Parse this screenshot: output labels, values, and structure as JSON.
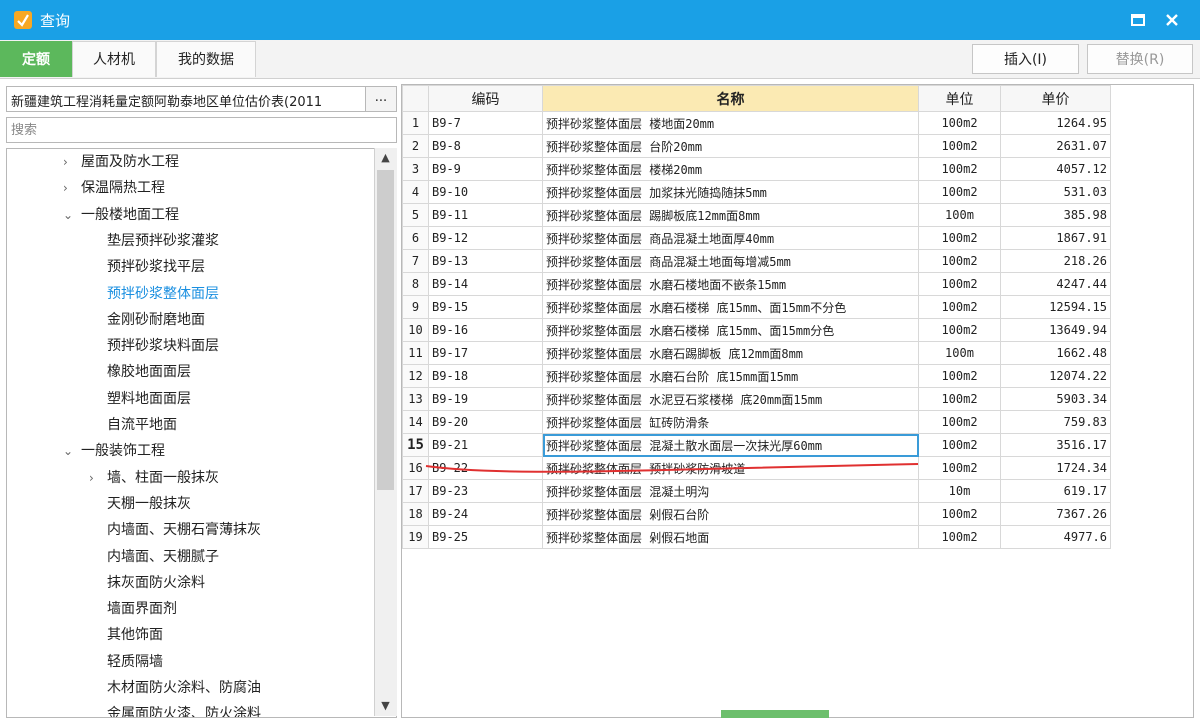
{
  "window": {
    "title": "查询",
    "maximize_icon": "maximize-icon",
    "close_icon": "close-icon",
    "accent": "#1aa0e6"
  },
  "tabs": [
    {
      "label": "定额",
      "active": true
    },
    {
      "label": "人材机",
      "active": false
    },
    {
      "label": "我的数据",
      "active": false
    }
  ],
  "toolbar": {
    "insert_label": "插入(I)",
    "replace_label": "替换(R)"
  },
  "library": {
    "name": "新疆建筑工程消耗量定额阿勒泰地区单位估价表(2011",
    "more_label": "..."
  },
  "search": {
    "placeholder": "搜索",
    "value": ""
  },
  "tree": [
    {
      "label": "屋面及防水工程",
      "level": 1,
      "caret": "›"
    },
    {
      "label": "保温隔热工程",
      "level": 1,
      "caret": "›"
    },
    {
      "label": "一般楼地面工程",
      "level": 1,
      "caret": "⌄"
    },
    {
      "label": "垫层预拌砂浆灌浆",
      "level": 2,
      "caret": ""
    },
    {
      "label": "预拌砂浆找平层",
      "level": 2,
      "caret": ""
    },
    {
      "label": "预拌砂浆整体面层",
      "level": 2,
      "caret": "",
      "selected": true
    },
    {
      "label": "金刚砂耐磨地面",
      "level": 2,
      "caret": ""
    },
    {
      "label": "预拌砂浆块料面层",
      "level": 2,
      "caret": ""
    },
    {
      "label": "橡胶地面面层",
      "level": 2,
      "caret": ""
    },
    {
      "label": "塑料地面面层",
      "level": 2,
      "caret": ""
    },
    {
      "label": "自流平地面",
      "level": 2,
      "caret": ""
    },
    {
      "label": "一般装饰工程",
      "level": 1,
      "caret": "⌄"
    },
    {
      "label": "墙、柱面一般抹灰",
      "level": 2,
      "caret": "›"
    },
    {
      "label": "天棚一般抹灰",
      "level": 2,
      "caret": ""
    },
    {
      "label": "内墙面、天棚石膏薄抹灰",
      "level": 2,
      "caret": ""
    },
    {
      "label": "内墙面、天棚腻子",
      "level": 2,
      "caret": ""
    },
    {
      "label": "抹灰面防火涂料",
      "level": 2,
      "caret": ""
    },
    {
      "label": "墙面界面剂",
      "level": 2,
      "caret": ""
    },
    {
      "label": "其他饰面",
      "level": 2,
      "caret": ""
    },
    {
      "label": "轻质隔墙",
      "level": 2,
      "caret": ""
    },
    {
      "label": "木材面防火涂料、防腐油",
      "level": 2,
      "caret": ""
    },
    {
      "label": "金属面防火漆、防火涂料",
      "level": 2,
      "caret": ""
    }
  ],
  "table": {
    "headers": [
      "编码",
      "名称",
      "单位",
      "单价"
    ],
    "selected_row": 15,
    "rows": [
      {
        "no": "1",
        "code": "B9-7",
        "name": "预拌砂浆整体面层 楼地面20mm",
        "unit": "100m2",
        "price": "1264.95"
      },
      {
        "no": "2",
        "code": "B9-8",
        "name": "预拌砂浆整体面层 台阶20mm",
        "unit": "100m2",
        "price": "2631.07"
      },
      {
        "no": "3",
        "code": "B9-9",
        "name": "预拌砂浆整体面层 楼梯20mm",
        "unit": "100m2",
        "price": "4057.12"
      },
      {
        "no": "4",
        "code": "B9-10",
        "name": "预拌砂浆整体面层 加浆抹光随捣随抹5mm",
        "unit": "100m2",
        "price": "531.03"
      },
      {
        "no": "5",
        "code": "B9-11",
        "name": "预拌砂浆整体面层 踢脚板底12mm面8mm",
        "unit": "100m",
        "price": "385.98"
      },
      {
        "no": "6",
        "code": "B9-12",
        "name": "预拌砂浆整体面层 商品混凝土地面厚40mm",
        "unit": "100m2",
        "price": "1867.91"
      },
      {
        "no": "7",
        "code": "B9-13",
        "name": "预拌砂浆整体面层 商品混凝土地面每增减5mm",
        "unit": "100m2",
        "price": "218.26"
      },
      {
        "no": "8",
        "code": "B9-14",
        "name": "预拌砂浆整体面层 水磨石楼地面不嵌条15mm",
        "unit": "100m2",
        "price": "4247.44"
      },
      {
        "no": "9",
        "code": "B9-15",
        "name": "预拌砂浆整体面层 水磨石楼梯 底15mm、面15mm不分色",
        "unit": "100m2",
        "price": "12594.15"
      },
      {
        "no": "10",
        "code": "B9-16",
        "name": "预拌砂浆整体面层 水磨石楼梯 底15mm、面15mm分色",
        "unit": "100m2",
        "price": "13649.94"
      },
      {
        "no": "11",
        "code": "B9-17",
        "name": "预拌砂浆整体面层 水磨石踢脚板 底12mm面8mm",
        "unit": "100m",
        "price": "1662.48"
      },
      {
        "no": "12",
        "code": "B9-18",
        "name": "预拌砂浆整体面层 水磨石台阶 底15mm面15mm",
        "unit": "100m2",
        "price": "12074.22"
      },
      {
        "no": "13",
        "code": "B9-19",
        "name": "预拌砂浆整体面层 水泥豆石浆楼梯 底20mm面15mm",
        "unit": "100m2",
        "price": "5903.34"
      },
      {
        "no": "14",
        "code": "B9-20",
        "name": "预拌砂浆整体面层 缸砖防滑条",
        "unit": "100m2",
        "price": "759.83"
      },
      {
        "no": "15",
        "code": "B9-21",
        "name": "预拌砂浆整体面层 混凝土散水面层一次抹光厚60mm",
        "unit": "100m2",
        "price": "3516.17"
      },
      {
        "no": "16",
        "code": "B9-22",
        "name": "预拌砂浆整体面层 预拌砂浆防滑坡道",
        "unit": "100m2",
        "price": "1724.34"
      },
      {
        "no": "17",
        "code": "B9-23",
        "name": "预拌砂浆整体面层 混凝土明沟",
        "unit": "10m",
        "price": "619.17"
      },
      {
        "no": "18",
        "code": "B9-24",
        "name": "预拌砂浆整体面层 剁假石台阶",
        "unit": "100m2",
        "price": "7367.26"
      },
      {
        "no": "19",
        "code": "B9-25",
        "name": "预拌砂浆整体面层 剁假石地面",
        "unit": "100m2",
        "price": "4977.6"
      }
    ]
  }
}
